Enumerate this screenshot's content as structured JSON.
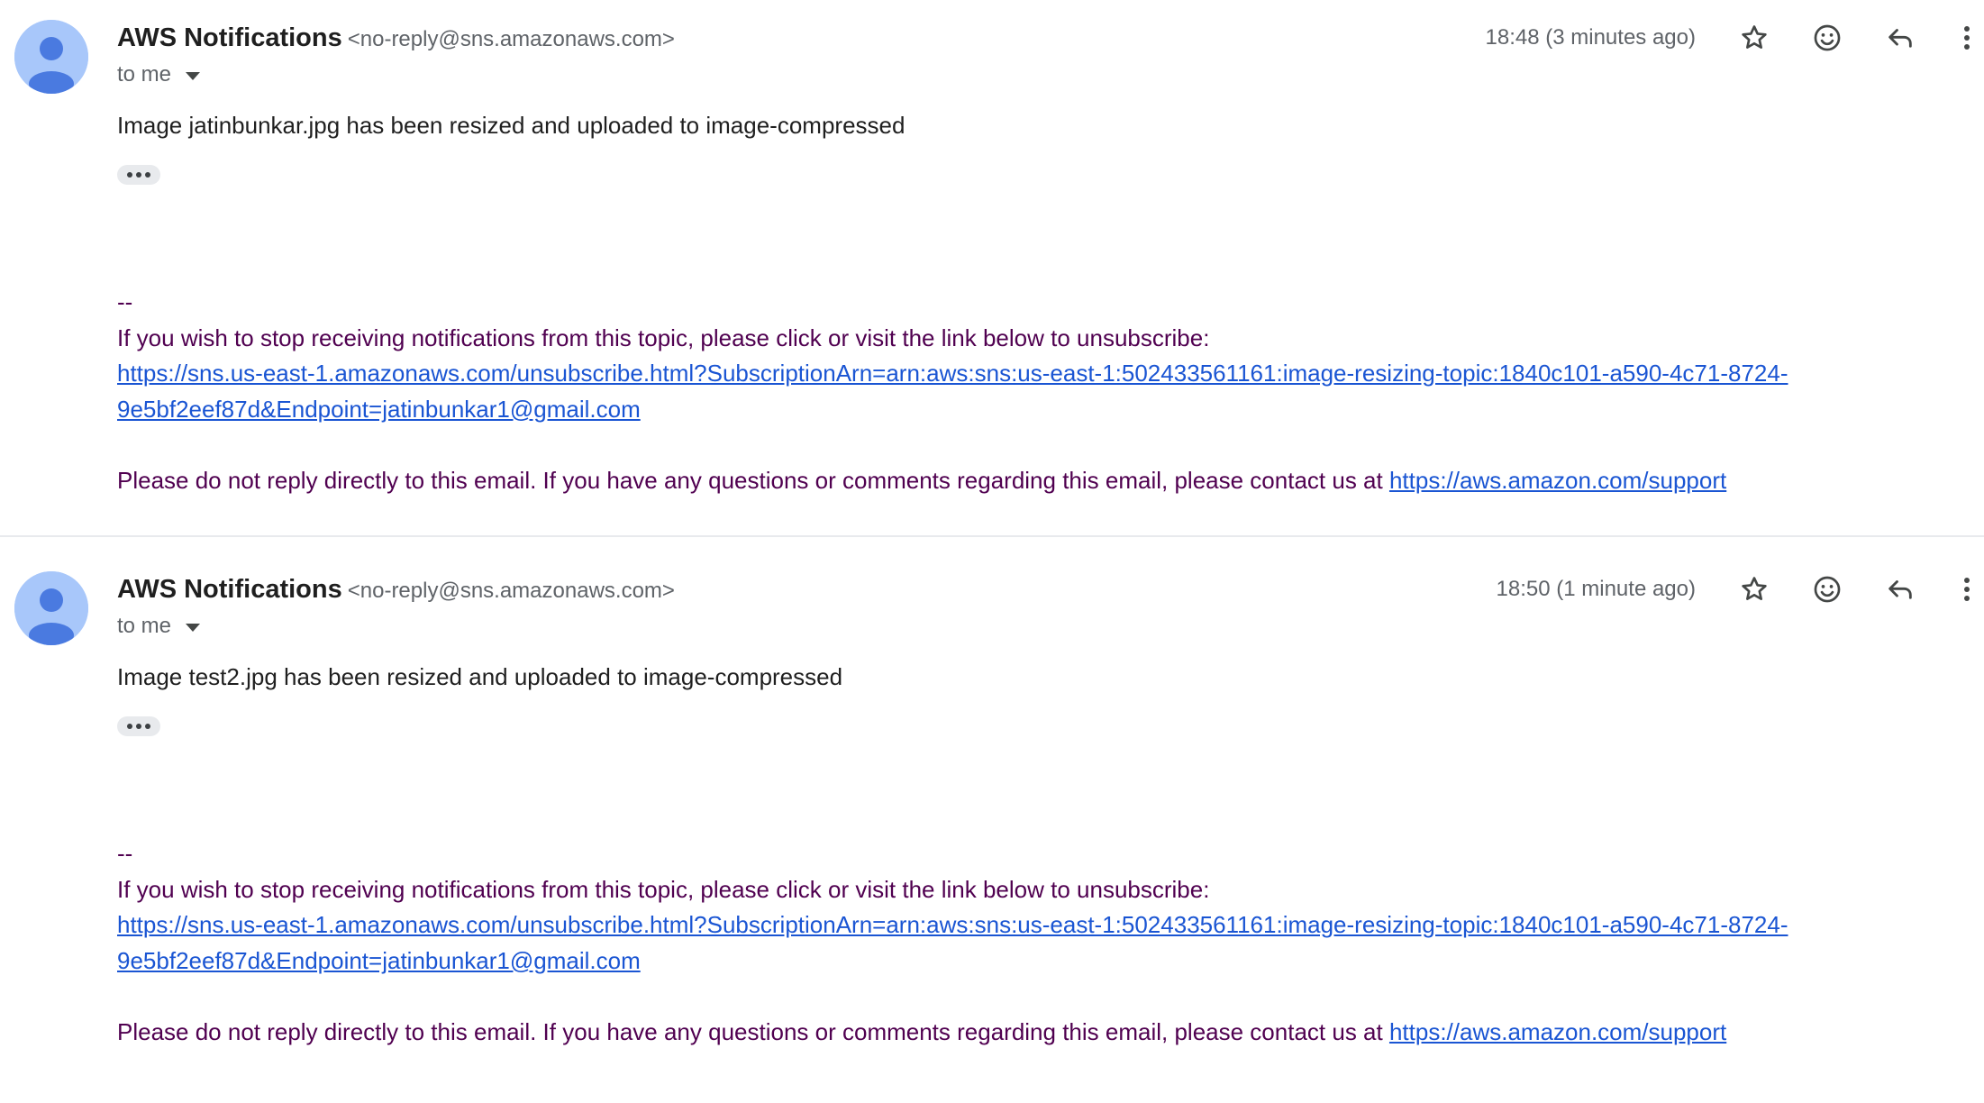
{
  "messages": [
    {
      "sender_name": "AWS Notifications",
      "sender_email": "<no-reply@sns.amazonaws.com>",
      "recipient": "to me",
      "timestamp": "18:48 (3 minutes ago)",
      "body": "Image jatinbunkar.jpg has been resized and uploaded to image-compressed",
      "signature_separator": "--",
      "unsubscribe_text": "If you wish to stop receiving notifications from this topic, please click or visit the link below to unsubscribe:",
      "unsubscribe_link_line1": "https://sns.us-east-1.amazonaws.com/unsubscribe.html?SubscriptionArn=arn:aws:sns:us-east-1:502433561161:image-resizing-topic:1840c101-a590-4c71-8724-",
      "unsubscribe_link_line2": "9e5bf2eef87d&Endpoint=jatinbunkar1@gmail.com",
      "noreply_text": "Please do not reply directly to this email. If you have any questions or comments regarding this email, please contact us at ",
      "support_link": "https://aws.amazon.com/support"
    },
    {
      "sender_name": "AWS Notifications",
      "sender_email": "<no-reply@sns.amazonaws.com>",
      "recipient": "to me",
      "timestamp": "18:50 (1 minute ago)",
      "body": "Image test2.jpg has been resized and uploaded to image-compressed",
      "signature_separator": "--",
      "unsubscribe_text": "If you wish to stop receiving notifications from this topic, please click or visit the link below to unsubscribe:",
      "unsubscribe_link_line1": "https://sns.us-east-1.amazonaws.com/unsubscribe.html?SubscriptionArn=arn:aws:sns:us-east-1:502433561161:image-resizing-topic:1840c101-a590-4c71-8724-",
      "unsubscribe_link_line2": "9e5bf2eef87d&Endpoint=jatinbunkar1@gmail.com",
      "noreply_text": "Please do not reply directly to this email. If you have any questions or comments regarding this email, please contact us at ",
      "support_link": "https://aws.amazon.com/support"
    }
  ],
  "icons": {
    "avatar": "person-avatar-icon",
    "star": "star-outline-icon",
    "emoji": "emoji-reaction-icon",
    "reply": "reply-arrow-icon",
    "more": "more-vertical-icon",
    "recipient_details": "chevron-down-icon",
    "trimmed_content": "ellipsis-icon"
  },
  "colors": {
    "avatar_bg": "#a8c7fa",
    "avatar_fg": "#4a7ae0",
    "link": "#1a55d3",
    "quoted_text": "#500050",
    "secondary_text": "#5f6368"
  }
}
